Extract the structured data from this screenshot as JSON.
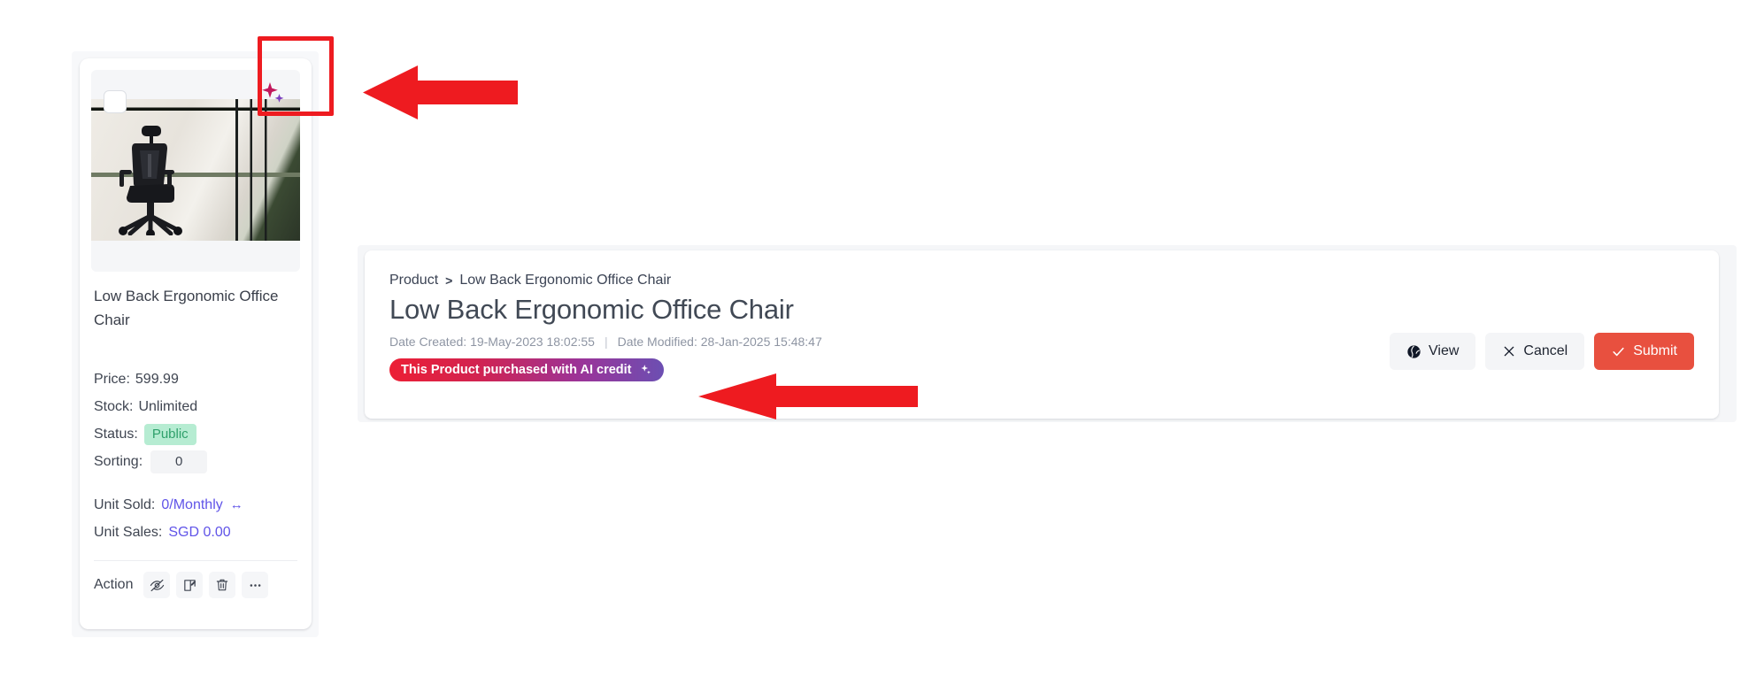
{
  "colors": {
    "annotation_red": "#ee1b20",
    "badge_gradient_from": "#ec1f35",
    "badge_gradient_to": "#6c4fb2",
    "submit_red": "#e8503f",
    "status_green_text": "#2fa06b",
    "status_green_bg": "#b6ecd2",
    "link_purple": "#6054e8",
    "panel_bg": "#f5f6f8"
  },
  "product_card": {
    "checkbox": {
      "name": "select-product-checkbox",
      "checked": false
    },
    "ai_icon_name": "ai-sparkle-icon",
    "image_alt": "Low Back Ergonomic Office Chair photo",
    "title": "Low Back Ergonomic Office Chair",
    "fields": [
      {
        "label": "Price:",
        "value": "599.99"
      },
      {
        "label": "Stock:",
        "value": "Unlimited"
      }
    ],
    "price_label": "Price:",
    "price_value": "599.99",
    "stock_label": "Stock:",
    "stock_value": "Unlimited",
    "status_label": "Status:",
    "status_value": "Public",
    "sorting_label": "Sorting:",
    "sorting_value": "0",
    "unit_sold_label": "Unit Sold:",
    "unit_sold_value": "0/Monthly",
    "unit_sales_label": "Unit Sales:",
    "unit_sales_value": "SGD 0.00",
    "action_label": "Action",
    "action_buttons": [
      {
        "name": "hide-product-button",
        "icon": "eye-off-icon"
      },
      {
        "name": "edit-product-button",
        "icon": "edit-square-icon"
      },
      {
        "name": "delete-product-button",
        "icon": "trash-icon"
      },
      {
        "name": "more-options-button",
        "icon": "ellipsis-icon"
      }
    ]
  },
  "detail_panel": {
    "breadcrumb": {
      "root": "Product",
      "separator": ">",
      "current": "Low Back Ergonomic Office Chair"
    },
    "title": "Low Back Ergonomic Office Chair",
    "date_created_label": "Date Created:",
    "date_created_value": "19-May-2023 18:02:55",
    "date_separator": "|",
    "date_modified_label": "Date Modified:",
    "date_modified_value": "28-Jan-2025 15:48:47",
    "ai_badge_text": "This Product purchased with AI credit",
    "ai_badge_icon": "ai-sparkle-icon",
    "buttons": [
      {
        "name": "view-button",
        "label": "View",
        "icon": "globe-icon",
        "style": "light"
      },
      {
        "name": "cancel-button",
        "label": "Cancel",
        "icon": "close-x-icon",
        "style": "light"
      },
      {
        "name": "submit-button",
        "label": "Submit",
        "icon": "check-icon",
        "style": "primary"
      }
    ],
    "view_label": "View",
    "cancel_label": "Cancel",
    "submit_label": "Submit"
  },
  "annotations": {
    "highlight_box_target": "ai-sparkle-icon-on-product-card",
    "arrow_1_target": "ai-sparkle-icon-on-product-card",
    "arrow_2_target": "ai-credit-badge"
  }
}
